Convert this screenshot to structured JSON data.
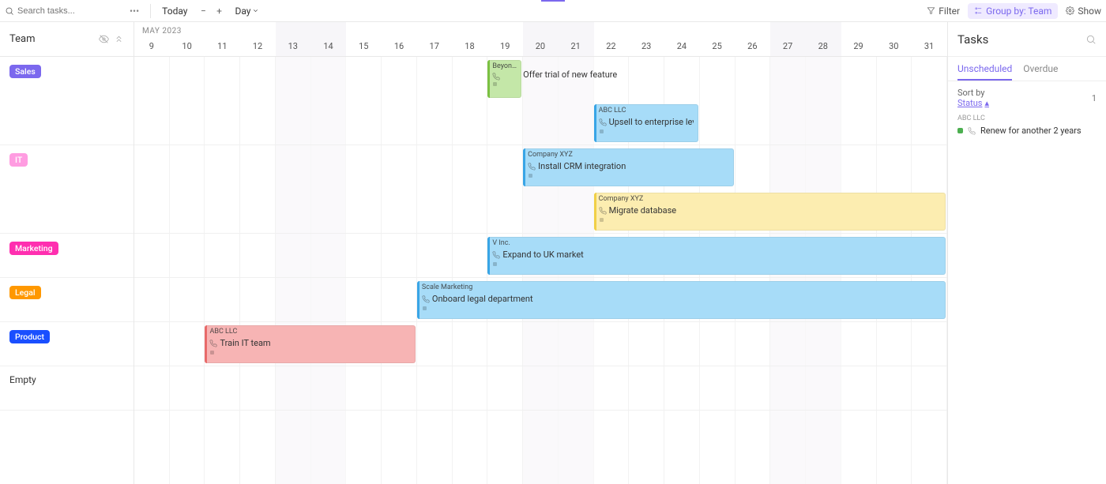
{
  "toolbar": {
    "search_placeholder": "Search tasks...",
    "today_label": "Today",
    "view_mode": "Day",
    "filter_label": "Filter",
    "group_label": "Group by: Team",
    "show_label": "Show"
  },
  "team_header": "Team",
  "month_label": "MAY 2023",
  "days": [
    {
      "d": "9",
      "weekend": false
    },
    {
      "d": "10",
      "weekend": false
    },
    {
      "d": "11",
      "weekend": false
    },
    {
      "d": "12",
      "weekend": false
    },
    {
      "d": "13",
      "weekend": true
    },
    {
      "d": "14",
      "weekend": true
    },
    {
      "d": "15",
      "weekend": false
    },
    {
      "d": "16",
      "weekend": false
    },
    {
      "d": "17",
      "weekend": false
    },
    {
      "d": "18",
      "weekend": false
    },
    {
      "d": "19",
      "weekend": false
    },
    {
      "d": "20",
      "weekend": true
    },
    {
      "d": "21",
      "weekend": true
    },
    {
      "d": "22",
      "weekend": false
    },
    {
      "d": "23",
      "weekend": false
    },
    {
      "d": "24",
      "weekend": false
    },
    {
      "d": "25",
      "weekend": false
    },
    {
      "d": "26",
      "weekend": false
    },
    {
      "d": "27",
      "weekend": true
    },
    {
      "d": "28",
      "weekend": true
    },
    {
      "d": "29",
      "weekend": false
    },
    {
      "d": "30",
      "weekend": false
    },
    {
      "d": "31",
      "weekend": false
    }
  ],
  "groups": [
    {
      "name": "Sales",
      "color": "#7b68ee",
      "height": "tall"
    },
    {
      "name": "IT",
      "color": "#ff9ce1",
      "height": "tall"
    },
    {
      "name": "Marketing",
      "color": "#ff2fb0",
      "height": "short"
    },
    {
      "name": "Legal",
      "color": "#ff9800",
      "height": "short"
    },
    {
      "name": "Product",
      "color": "#1a4fff",
      "height": "short"
    },
    {
      "name": "Empty",
      "color": "",
      "height": "short"
    }
  ],
  "tasks": [
    {
      "row": 0,
      "sub": 0,
      "start": 10,
      "span": 1,
      "client": "Beyond I...",
      "title": "",
      "bg": "#c4e7a8",
      "accent": "#7bc142"
    },
    {
      "row": 0,
      "sub": 0,
      "start": 11,
      "span": 0,
      "milestone": "Offer trial of new feature"
    },
    {
      "row": 0,
      "sub": 1,
      "start": 13,
      "span": 3,
      "client": "ABC LLC",
      "title": "Upsell to enterprise level",
      "bg": "#a7dcf8",
      "accent": "#39a5e6"
    },
    {
      "row": 1,
      "sub": 0,
      "start": 11,
      "span": 6,
      "client": "Company XYZ",
      "title": "Install CRM integration",
      "bg": "#a7dcf8",
      "accent": "#39a5e6"
    },
    {
      "row": 1,
      "sub": 1,
      "start": 13,
      "span": 14,
      "client": "Company XYZ",
      "title": "Migrate database",
      "bg": "#fcedb0",
      "accent": "#f1d047"
    },
    {
      "row": 2,
      "sub": 0,
      "start": 10,
      "span": 17,
      "client": "V Inc.",
      "title": "Expand to UK market",
      "bg": "#a7dcf8",
      "accent": "#39a5e6"
    },
    {
      "row": 3,
      "sub": 0,
      "start": 8,
      "span": 19,
      "client": "Scale Marketing",
      "title": "Onboard legal department",
      "bg": "#a7dcf8",
      "accent": "#39a5e6"
    },
    {
      "row": 4,
      "sub": 0,
      "start": 2,
      "span": 6,
      "client": "ABC LLC",
      "title": "Train IT team",
      "bg": "#f7b4b4",
      "accent": "#e86a6a"
    }
  ],
  "sidebar": {
    "title": "Tasks",
    "tabs": [
      "Unscheduled",
      "Overdue"
    ],
    "active_tab": 0,
    "sort_prefix": "Sort by",
    "sort_value": "Status",
    "count": "1",
    "group_client": "ABC LLC",
    "item_title": "Renew for another 2 years"
  }
}
